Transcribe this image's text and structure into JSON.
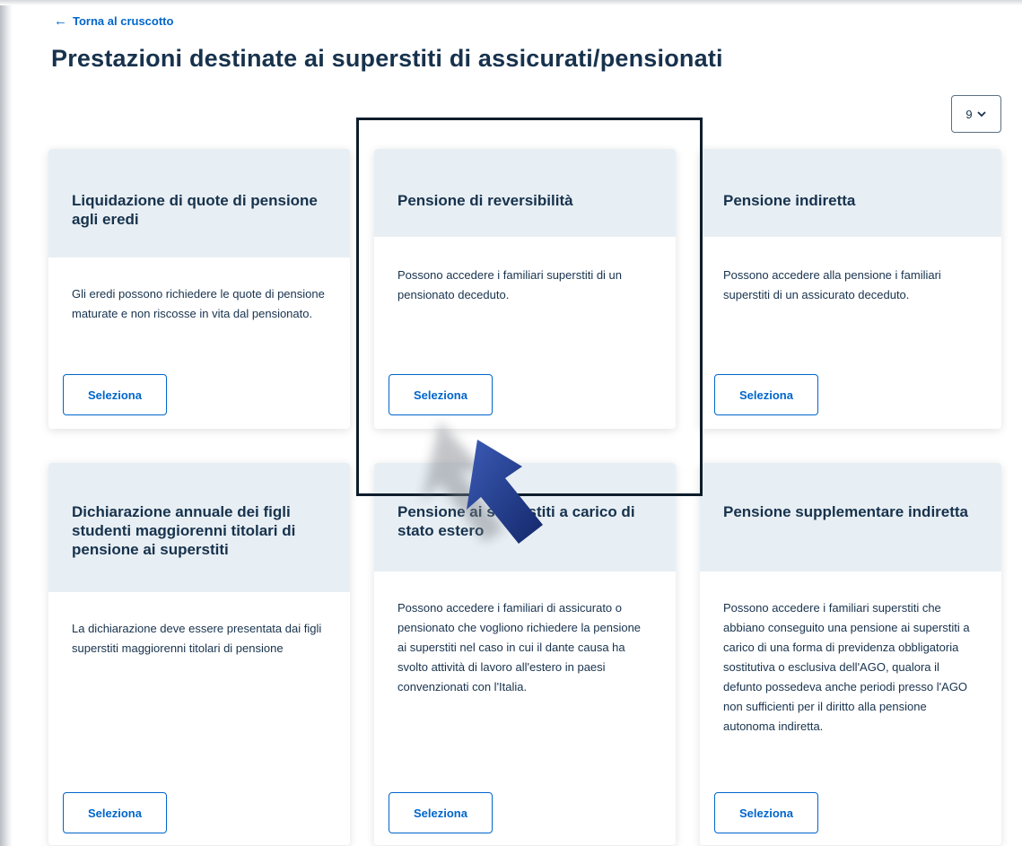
{
  "header": {
    "back_label": "Torna al cruscotto",
    "page_title": "Prestazioni destinate ai superstiti di assicurati/pensionati"
  },
  "pagination": {
    "per_page_value": "9"
  },
  "cards": [
    {
      "title": "Liquidazione di quote di pensione agli eredi",
      "description": "Gli eredi possono richiedere le quote di pensione maturate e non riscosse in vita dal pensionato.",
      "button": "Seleziona"
    },
    {
      "title": "Pensione di reversibilità",
      "description": "Possono accedere i familiari superstiti di un pensionato deceduto.",
      "button": "Seleziona"
    },
    {
      "title": "Pensione indiretta",
      "description": "Possono accedere alla pensione i familiari superstiti di un assicurato deceduto.",
      "button": "Seleziona"
    },
    {
      "title": "Dichiarazione annuale dei figli studenti maggiorenni titolari di pensione ai superstiti",
      "description": "La dichiarazione deve essere presentata dai figli superstiti maggiorenni titolari di pensione",
      "button": "Seleziona"
    },
    {
      "title": "Pensione ai superstiti a carico di stato estero",
      "description": "Possono accedere i familiari di assicurato o pensionato che vogliono richiedere la pensione ai superstiti nel caso in cui il dante causa ha svolto attività di lavoro all'estero in paesi convenzionati con l'Italia.",
      "button": "Seleziona"
    },
    {
      "title": "Pensione supplementare indiretta",
      "description": "Possono accedere i familiari superstiti che abbiano conseguito una pensione ai superstiti a carico di una forma di previdenza obbligatoria sostitutiva o esclusiva dell'AGO, qualora il defunto possedeva anche periodi presso l'AGO non sufficienti per il diritto alla pensione autonoma indiretta.",
      "button": "Seleziona"
    }
  ],
  "colors": {
    "primary": "#0066cc",
    "text": "#17324d",
    "card_header_bg": "#e8eff4",
    "annotation": "#0e1d2b",
    "annotation_arrow": "#1f3a8a"
  },
  "icons": {
    "back": "arrow-left-icon",
    "dropdown": "chevron-down-icon",
    "annotation": "arrow-up-left-annotation"
  }
}
